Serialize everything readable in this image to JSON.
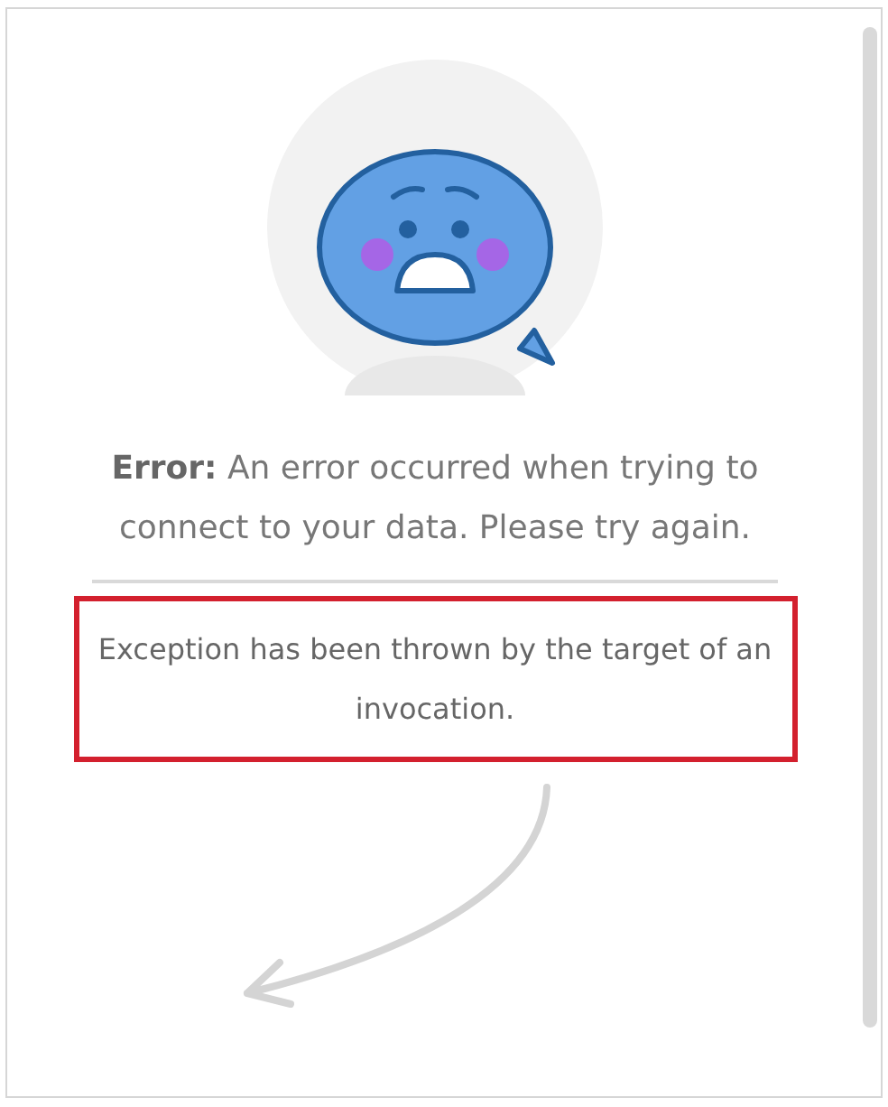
{
  "error_message": "**Error:** An error occurred when trying to connect to your data. Please try again.",
  "details": {
    "text": "Exception has been thrown by the target of an invocation.",
    "highlighted": true
  }
}
